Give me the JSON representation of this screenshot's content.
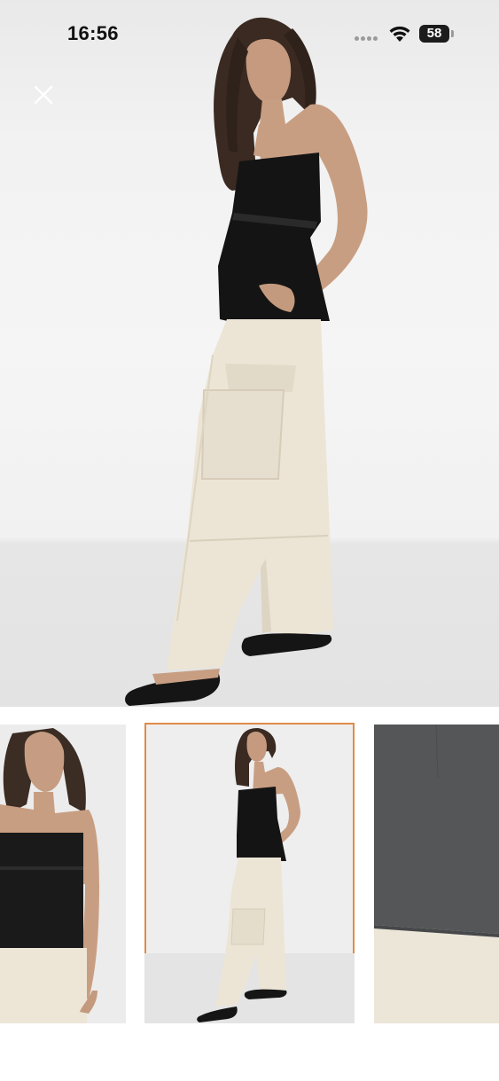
{
  "status_bar": {
    "time": "16:56",
    "battery_level": "58",
    "icons": [
      "signal-dots-icon",
      "wifi-icon",
      "battery-icon"
    ]
  },
  "viewer": {
    "close_icon": "close-icon",
    "main_image": "product-photo-full-length",
    "selected_thumbnail_index": 1,
    "accent_color": "#e08b47"
  },
  "thumbnails": [
    {
      "name": "product-photo-closeup-front"
    },
    {
      "name": "product-photo-full-length",
      "selected": true
    },
    {
      "name": "product-photo-fabric-detail"
    }
  ]
}
